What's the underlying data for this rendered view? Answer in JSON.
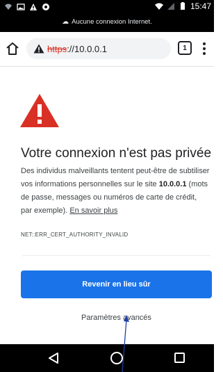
{
  "status_bar": {
    "time": "15:47",
    "network_message": "Aucune connexion Internet."
  },
  "toolbar": {
    "url_scheme": "https",
    "url_rest": "://10.0.0.1",
    "tab_count": "1"
  },
  "interstitial": {
    "title": "Votre connexion n'est pas privée",
    "description_before": "Des individus malveillants tentent peut-être de subtiliser vos informations personnelles sur le site ",
    "description_host": "10.0.0.1",
    "description_after": " (mots de passe, messages ou numéros de carte de crédit, par exemple). ",
    "learn_more": "En savoir plus",
    "error_code": "NET::ERR_CERT_AUTHORITY_INVALID",
    "back_button": "Revenir en lieu sûr",
    "advanced_link": "Paramètres avancés"
  },
  "colors": {
    "warning_red": "#d93025",
    "primary_blue": "#1a73e8",
    "status_bar_bg": "#000000",
    "annotation_arrow": "#1f3fa8"
  },
  "icons": {
    "home": "home-icon",
    "warning": "warning-triangle-icon",
    "tabs": "tab-switcher-icon",
    "menu": "more-vert-icon",
    "nav_back": "triangle-back-icon",
    "nav_home": "circle-home-icon",
    "nav_recent": "square-recents-icon"
  }
}
